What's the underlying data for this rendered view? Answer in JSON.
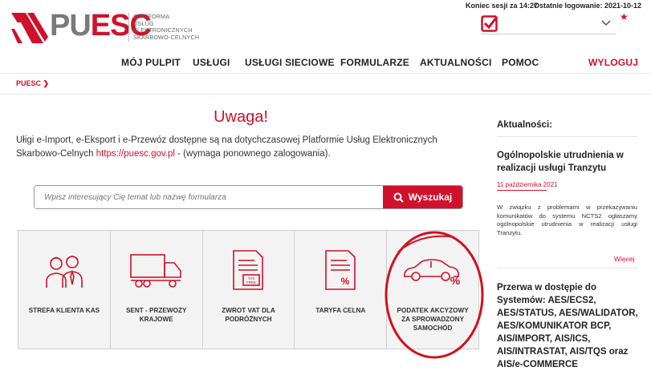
{
  "session": {
    "expiry_label": "Koniec sesji za 14:27",
    "last_login_label": "Ostatnie logowanie: 2021-10-12"
  },
  "logo": {
    "brand_pu": "PU",
    "brand_esc": "ESC",
    "subtitle": [
      "PLATFORMA",
      "USŁUG",
      "ELEKTRONICZNYCH",
      "SKARBOWO-CELNYCH"
    ]
  },
  "nav": {
    "items": [
      "MÓJ PULPIT",
      "USŁUGI",
      "USŁUGI SIECIOWE",
      "FORMULARZE",
      "AKTUALNOŚCI",
      "POMOC"
    ],
    "logout": "WYLOGUJ"
  },
  "breadcrumb": {
    "root": "PUESC"
  },
  "main": {
    "title": "Uwaga!",
    "intro_text": "Ułigi e-Import, e-Eksport i e-Przewóz dostępne są na dotychczasowej Platformie Usług Elektronicznych Skarbowo-Celnych",
    "intro_link": "https://puesc.gov.pl",
    "intro_suffix": "- (wymaga ponownego zalogowania).",
    "search": {
      "placeholder": "Wpisz interesujący Cię temat lub nazwę formularza",
      "button_label": "Wyszukaj"
    },
    "tiles": [
      {
        "label": "STREFA KLIENTA KAS",
        "icon": "people-icon"
      },
      {
        "label": "SENT - PRZEWOZY KRAJOWE",
        "icon": "truck-icon"
      },
      {
        "label": "ZWROT VAT DLA PODRÓŻNYCH",
        "icon": "tax-free-document-icon"
      },
      {
        "label": "TARYFA CELNA",
        "icon": "percent-document-icon"
      },
      {
        "label": "PODATEK AKCYZOWY ZA SPROWADZONY SAMOCHÓD",
        "icon": "car-percent-icon"
      }
    ]
  },
  "sidebar": {
    "heading": "Aktualności:",
    "news": [
      {
        "title": "Ogólnopolskie utrudnienia w realizacji usługi Tranzytu",
        "date": "11 października 2021",
        "body": "W związku z problemami w przekazywaniu komunikatów do systemu NCTS2 ogłaszamy ogólnopolskie utrudnienia w realizacji usługi Tranzytu.",
        "more": "Więcej"
      },
      {
        "title": "Przerwa w dostępie do Systemów: AES/ECS2, AES/STATUS, AES/WALIDATOR, AES/KOMUNIKATOR BCP, AIS/IMPORT, AIS/ICS, AIS/INTRASTAT, AIS/TQS oraz AIS/e-COMMERCE"
      }
    ]
  },
  "colors": {
    "brand_red": "#d0112b",
    "tile_bg": "#f3f3f3",
    "annotation_red": "#d0111e"
  }
}
